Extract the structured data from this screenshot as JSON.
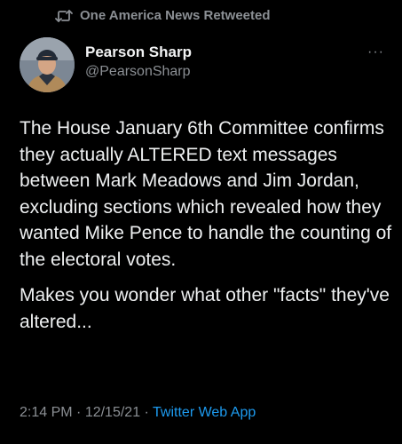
{
  "retweet": {
    "icon": "retweet-icon",
    "label": "One America News Retweeted"
  },
  "author": {
    "display_name": "Pearson Sharp",
    "handle": "@PearsonSharp"
  },
  "menu": {
    "icon": "more-icon",
    "label": "···"
  },
  "tweet": {
    "paragraphs": [
      "The House January 6th Committee confirms they actually ALTERED text messages between Mark Meadows and Jim Jordan, excluding sections which revealed how they wanted Mike Pence to handle the counting of the electoral votes.",
      "Makes you wonder what other \"facts\" they've altered..."
    ]
  },
  "meta": {
    "time": "2:14 PM",
    "separator_1": " · ",
    "date": "12/15/21",
    "separator_2": " · ",
    "source": "Twitter Web App"
  },
  "colors": {
    "background": "#000000",
    "text": "#e7e9ea",
    "secondary": "#8b8f94",
    "link": "#1d9bf0"
  }
}
